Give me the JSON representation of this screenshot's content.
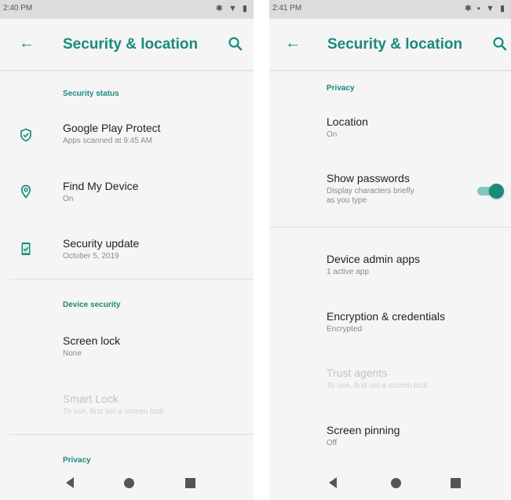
{
  "colors": {
    "accent": "#1a8a7a",
    "background": "#f5f5f5",
    "statusbar": "#dcdcdc"
  },
  "left": {
    "status": {
      "time": "2:40 PM",
      "icons": "✱ ▼ ▮"
    },
    "toolbar": {
      "back_icon": "arrow-left-icon",
      "title": "Security & location",
      "search_icon": "search-icon"
    },
    "sections": {
      "security_status": "Security status",
      "device_security": "Device security",
      "privacy": "Privacy"
    },
    "items": {
      "play_protect": {
        "title": "Google Play Protect",
        "summary": "Apps scanned at 9:45 AM",
        "icon": "shield-check-icon"
      },
      "find_device": {
        "title": "Find My Device",
        "summary": "On",
        "icon": "location-pin-icon"
      },
      "security_update": {
        "title": "Security update",
        "summary": "October 5, 2019",
        "icon": "phone-update-icon"
      },
      "screen_lock": {
        "title": "Screen lock",
        "summary": "None"
      },
      "smart_lock": {
        "title": "Smart Lock",
        "summary": "To use, first set a screen lock"
      }
    }
  },
  "right": {
    "status": {
      "time": "2:41 PM",
      "icons": "✱ ▪ ▼ ▮"
    },
    "toolbar": {
      "back_icon": "arrow-left-icon",
      "title": "Security & location",
      "search_icon": "search-icon"
    },
    "sections": {
      "privacy": "Privacy"
    },
    "items": {
      "location": {
        "title": "Location",
        "summary": "On"
      },
      "show_passwords": {
        "title": "Show passwords",
        "summary_line1": "Display characters briefly",
        "summary_line2": "as you type",
        "toggle_on": true
      },
      "device_admin": {
        "title": "Device admin apps",
        "summary": "1 active app"
      },
      "encryption": {
        "title": "Encryption & credentials",
        "summary": "Encrypted"
      },
      "trust_agents": {
        "title": "Trust agents",
        "summary": "To use, first set a screen lock"
      },
      "screen_pinning": {
        "title": "Screen pinning",
        "summary": "Off"
      }
    }
  },
  "navbar": {
    "back": "nav-back-icon",
    "home": "nav-home-icon",
    "recents": "nav-recents-icon"
  }
}
